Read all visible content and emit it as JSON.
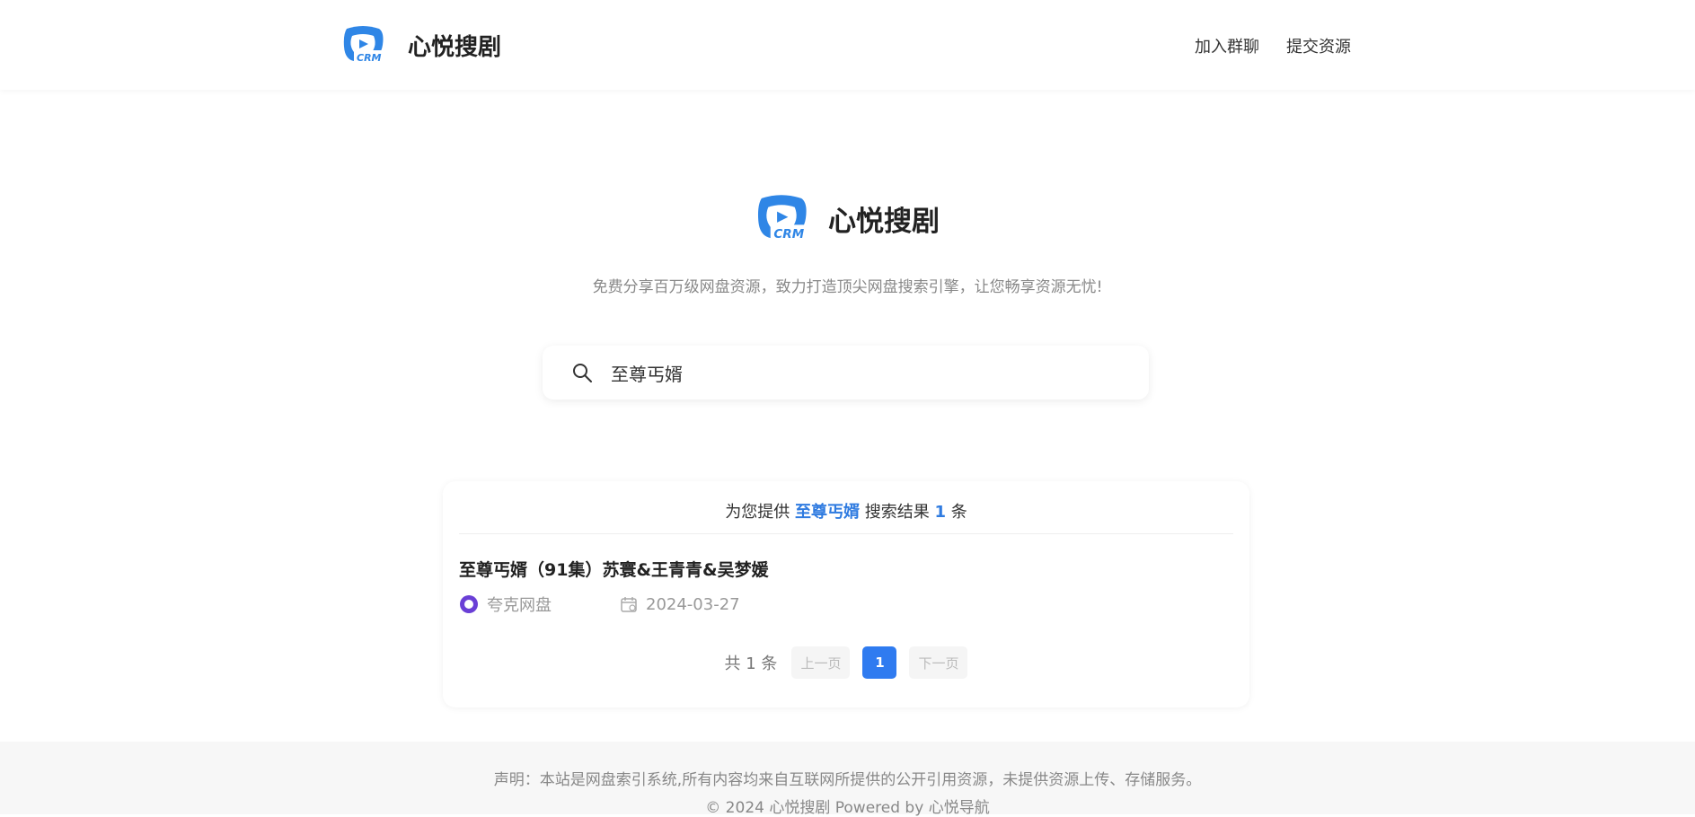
{
  "header": {
    "site_name": "心悦搜剧",
    "nav": [
      "加入群聊",
      "提交资源"
    ]
  },
  "hero": {
    "site_name": "心悦搜剧",
    "logo_text": "CRM",
    "slogan": "免费分享百万级网盘资源，致力打造顶尖网盘搜索引擎，让您畅享资源无忧!"
  },
  "search": {
    "value": "至尊丐婿"
  },
  "results": {
    "prefix": "为您提供",
    "keyword": "至尊丐婿",
    "middle": "搜索结果",
    "count": "1",
    "suffix": "条",
    "items": [
      {
        "title": "至尊丐婿（91集）苏寰&王青青&吴梦媛",
        "disk": "夸克网盘",
        "date": "2024-03-27"
      }
    ]
  },
  "pager": {
    "total": "共 1 条",
    "prev": "上一页",
    "current": "1",
    "next": "下一页"
  },
  "footer": {
    "disclaimer": "声明：本站是网盘索引系统,所有内容均来自互联网所提供的公开引用资源，未提供资源上传、存储服务。",
    "copyright": "© 2024 心悦搜剧 Powered by 心悦导航"
  },
  "colors": {
    "accent": "#2f7bf0",
    "disk_icon": "#6a3fd6"
  }
}
